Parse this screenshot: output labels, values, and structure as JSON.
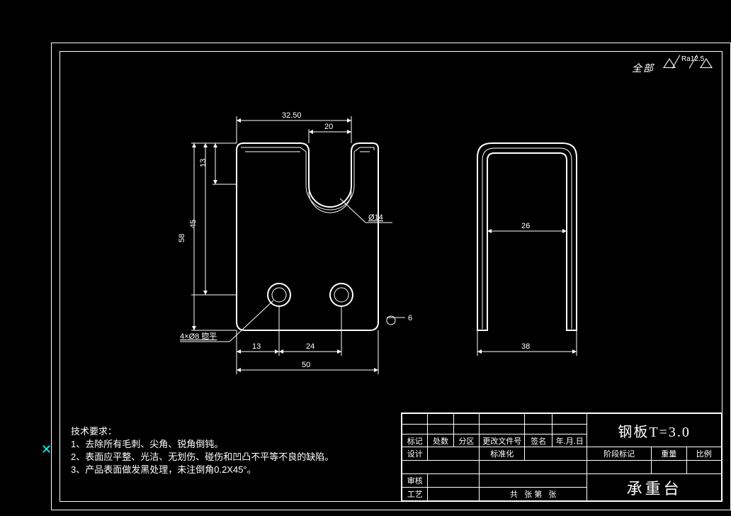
{
  "roughness": {
    "label": "全部",
    "ra": "Ra12.5"
  },
  "dimensions": {
    "top_width": "32.50",
    "slot_width": "20",
    "left_upper": "13",
    "left_mid": "45",
    "left_total": "58",
    "phi_hole": "Ø14",
    "holes_note": "4×Ø8 锪平",
    "bottom_offset": "13",
    "bottom_spacing": "24",
    "bottom_width": "50",
    "side_inner": "26",
    "side_outer": "38",
    "chamfer": "6"
  },
  "notes": {
    "heading": "技术要求：",
    "line1": "1、去除所有毛刺、尖角、锐角倒钝。",
    "line2": "2、表面应平整、光洁、无划伤、碰伤和凹凸不平等不良的缺陷。",
    "line3": "3、产品表面做发黑处理，未注倒角0.2X45°。"
  },
  "titleblock": {
    "row_headers": {
      "mark": "标记",
      "count": "处数",
      "zone": "分区",
      "docchange": "更改文件号",
      "sign": "签名",
      "date": "年.月.日"
    },
    "rows": {
      "design": "设计",
      "std": "标准化",
      "stagemark": "阶段标记",
      "weight": "重量",
      "scale": "比例",
      "audit": "审核",
      "tech": "工艺",
      "sheets_a": "共",
      "sheets_b": "张 第",
      "sheets_c": "张"
    },
    "material": "钢板T=3.0",
    "partname": "承重台"
  },
  "cursor": "✕"
}
